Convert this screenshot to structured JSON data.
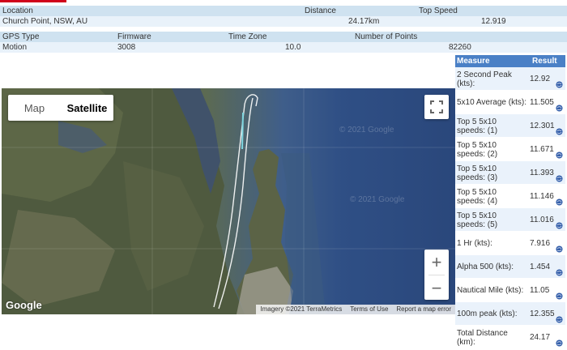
{
  "info": {
    "headers1": {
      "location": "Location",
      "distance": "Distance",
      "top_speed": "Top Speed"
    },
    "values1": {
      "location": "Church Point, NSW, AU",
      "distance": "24.17km",
      "top_speed": "12.919"
    },
    "headers2": {
      "gps_type": "GPS Type",
      "firmware": "Firmware",
      "time_zone": "Time Zone",
      "num_points": "Number of Points"
    },
    "values2": {
      "gps_type": "Motion",
      "firmware": "3008",
      "time_zone": "10.0",
      "num_points": "82260"
    }
  },
  "map": {
    "map_label": "Map",
    "satellite_label": "Satellite",
    "google_logo": "Google",
    "watermark": "© 2021 Google",
    "attribution": [
      "Imagery ©2021 TerraMetrics",
      "Terms of Use",
      "Report a map error"
    ],
    "zoom_in": "+",
    "zoom_out": "−",
    "colors": {
      "track": "#ffffff",
      "track_start": "#7fd6e0",
      "water": "#2f4f85"
    }
  },
  "results": {
    "header": {
      "measure": "Measure",
      "result": "Result"
    },
    "rows": [
      {
        "measure": "2 Second Peak (kts):",
        "result": "12.92"
      },
      {
        "measure": "5x10 Average (kts):",
        "result": "11.505"
      },
      {
        "measure": "Top 5 5x10 speeds: (1)",
        "result": "12.301"
      },
      {
        "measure": "Top 5 5x10 speeds: (2)",
        "result": "11.671"
      },
      {
        "measure": "Top 5 5x10 speeds: (3)",
        "result": "11.393"
      },
      {
        "measure": "Top 5 5x10 speeds: (4)",
        "result": "11.146"
      },
      {
        "measure": "Top 5 5x10 speeds: (5)",
        "result": "11.016"
      },
      {
        "measure": "1 Hr (kts):",
        "result": "7.916"
      },
      {
        "measure": "Alpha 500 (kts):",
        "result": "1.454"
      },
      {
        "measure": "Nautical Mile (kts):",
        "result": "11.05"
      },
      {
        "measure": "100m peak (kts):",
        "result": "12.355"
      },
      {
        "measure": "Total Distance (km):",
        "result": "24.17"
      }
    ],
    "icon": "globe-icon"
  }
}
